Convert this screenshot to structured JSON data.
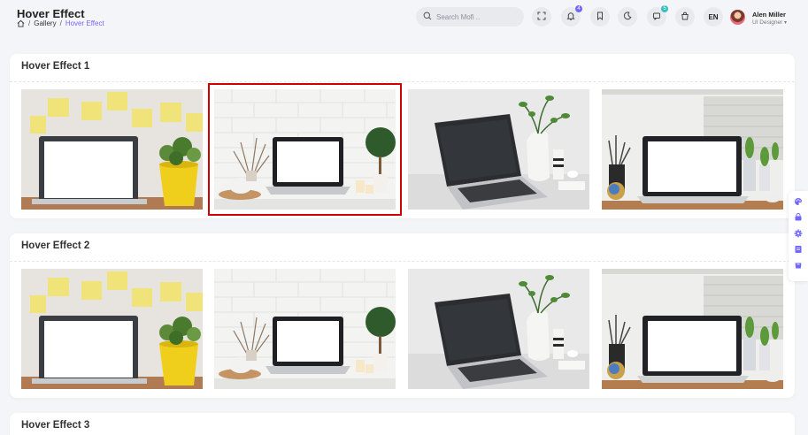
{
  "header": {
    "title": "Hover Effect",
    "breadcrumb": {
      "home": "home",
      "section": "Gallery",
      "current": "Hover Effect"
    },
    "search_placeholder": "Search Mofi ..",
    "notifications_badge": "4",
    "cart_badge": "5",
    "language": "EN",
    "user": {
      "name": "Alen Miller",
      "role": "UI Designer"
    }
  },
  "sections": [
    {
      "title": "Hover Effect 1"
    },
    {
      "title": "Hover Effect 2"
    },
    {
      "title": "Hover Effect 3"
    }
  ],
  "colors": {
    "accent": "#7366ff",
    "selection": "#d10000"
  }
}
